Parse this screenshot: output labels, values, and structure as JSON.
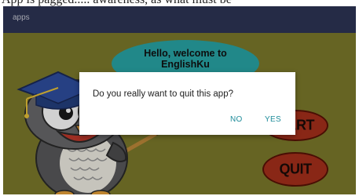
{
  "status_strip_text": "App is pagged..... awareness, as what must be",
  "app_bar": {
    "title": "apps"
  },
  "welcome_bubble": {
    "line1": "Hello, welcome to",
    "line2": "EnglishKu"
  },
  "buttons": {
    "start_label": "ART",
    "quit_label": "QUIT"
  },
  "dialog": {
    "message": "Do you really want to quit this app?",
    "no_label": "NO",
    "yes_label": "YES"
  },
  "colors": {
    "background": "#7d7b2b",
    "app_bar": "#2e3556",
    "bubble": "#29a6a8",
    "buttons": "#a8301c",
    "dialog_accent": "#1e8c9a"
  },
  "icons": [
    "owl-mascot-icon",
    "pointer-stick-icon",
    "graduation-cap-icon"
  ]
}
